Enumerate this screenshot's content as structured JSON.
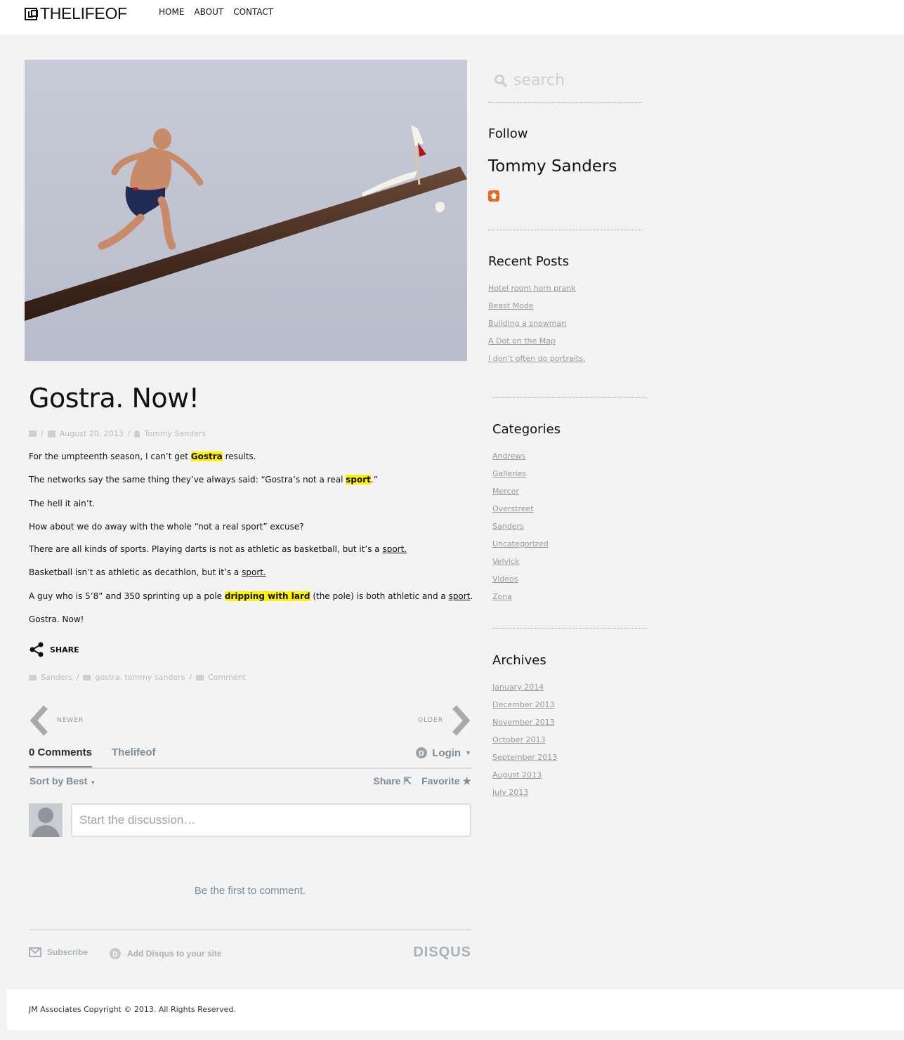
{
  "site": {
    "logo_text": "THELIFEOF"
  },
  "nav": [
    "HOME",
    "ABOUT",
    "CONTACT"
  ],
  "post": {
    "title": "Gostra. Now!",
    "meta": {
      "sep": "/",
      "date": "August 20, 2013",
      "author": "Tommy Sanders"
    },
    "share_label": "SHARE",
    "category": "Sanders",
    "tags": "gostra, tommy sanders",
    "comment_link": "Comment",
    "p1": {
      "a": "For the umpteenth season, I can’t get ",
      "hl": "Gostra",
      "b": " results."
    },
    "p2": {
      "a": "The networks say the same thing they’ve always said: “Gostra’s not a real ",
      "hl": "sport",
      "b": ".”"
    },
    "p3": "The hell it ain’t.",
    "p4": "How about we do away with the whole “not a real sport” excuse?",
    "p5": {
      "a": "There are all kinds of sports.  Playing darts is not as athletic as basketball, but it’s a ",
      "link": "sport."
    },
    "p6": {
      "a": "Basketball isn’t as athletic as decathlon, but it’s a ",
      "link": "sport."
    },
    "p7": {
      "a": "A guy who is 5’8” and 350 sprinting up a pole ",
      "hl": "dripping with lard",
      "b": " (the pole) is both athletic and a ",
      "link": "sport",
      "c": "."
    },
    "p8": "Gostra.  Now!"
  },
  "pager": {
    "newer": "NEWER",
    "older": "OLDER"
  },
  "disqus": {
    "count_label": "0 Comments",
    "site_name": "Thelifeof",
    "login": "Login",
    "sort": "Sort by Best",
    "share": "Share",
    "favorite": "Favorite",
    "placeholder": "Start the discussion…",
    "empty": "Be the first to comment.",
    "subscribe": "Subscribe",
    "add": "Add Disqus to your site",
    "brand": "DISQUS"
  },
  "sidebar": {
    "search_placeholder": "search",
    "follow_heading": "Follow",
    "follow_name": "Tommy Sanders",
    "recent_heading": "Recent Posts",
    "recent": [
      "Hotel room horn prank",
      "Beast Mode",
      "Building a snowman",
      "A Dot on the Map",
      "I don’t often do portraits."
    ],
    "categories_heading": "Categories",
    "categories": [
      "Andrews",
      "Galleries",
      "Mercer",
      "Overstreet",
      "Sanders",
      "Uncategorized",
      "Velvick",
      "Videos",
      "Zona"
    ],
    "archives_heading": "Archives",
    "archives": [
      "January 2014",
      "December 2013",
      "November 2013",
      "October 2013",
      "September 2013",
      "August 2013",
      "July 2013"
    ]
  },
  "footer": {
    "copyright": "JM Associates Copyright © 2013. All Rights Reserved."
  },
  "colors": {
    "highlight": "#fff200",
    "accent_home": "#e8671e",
    "page_bg": "#f3f3f3"
  }
}
